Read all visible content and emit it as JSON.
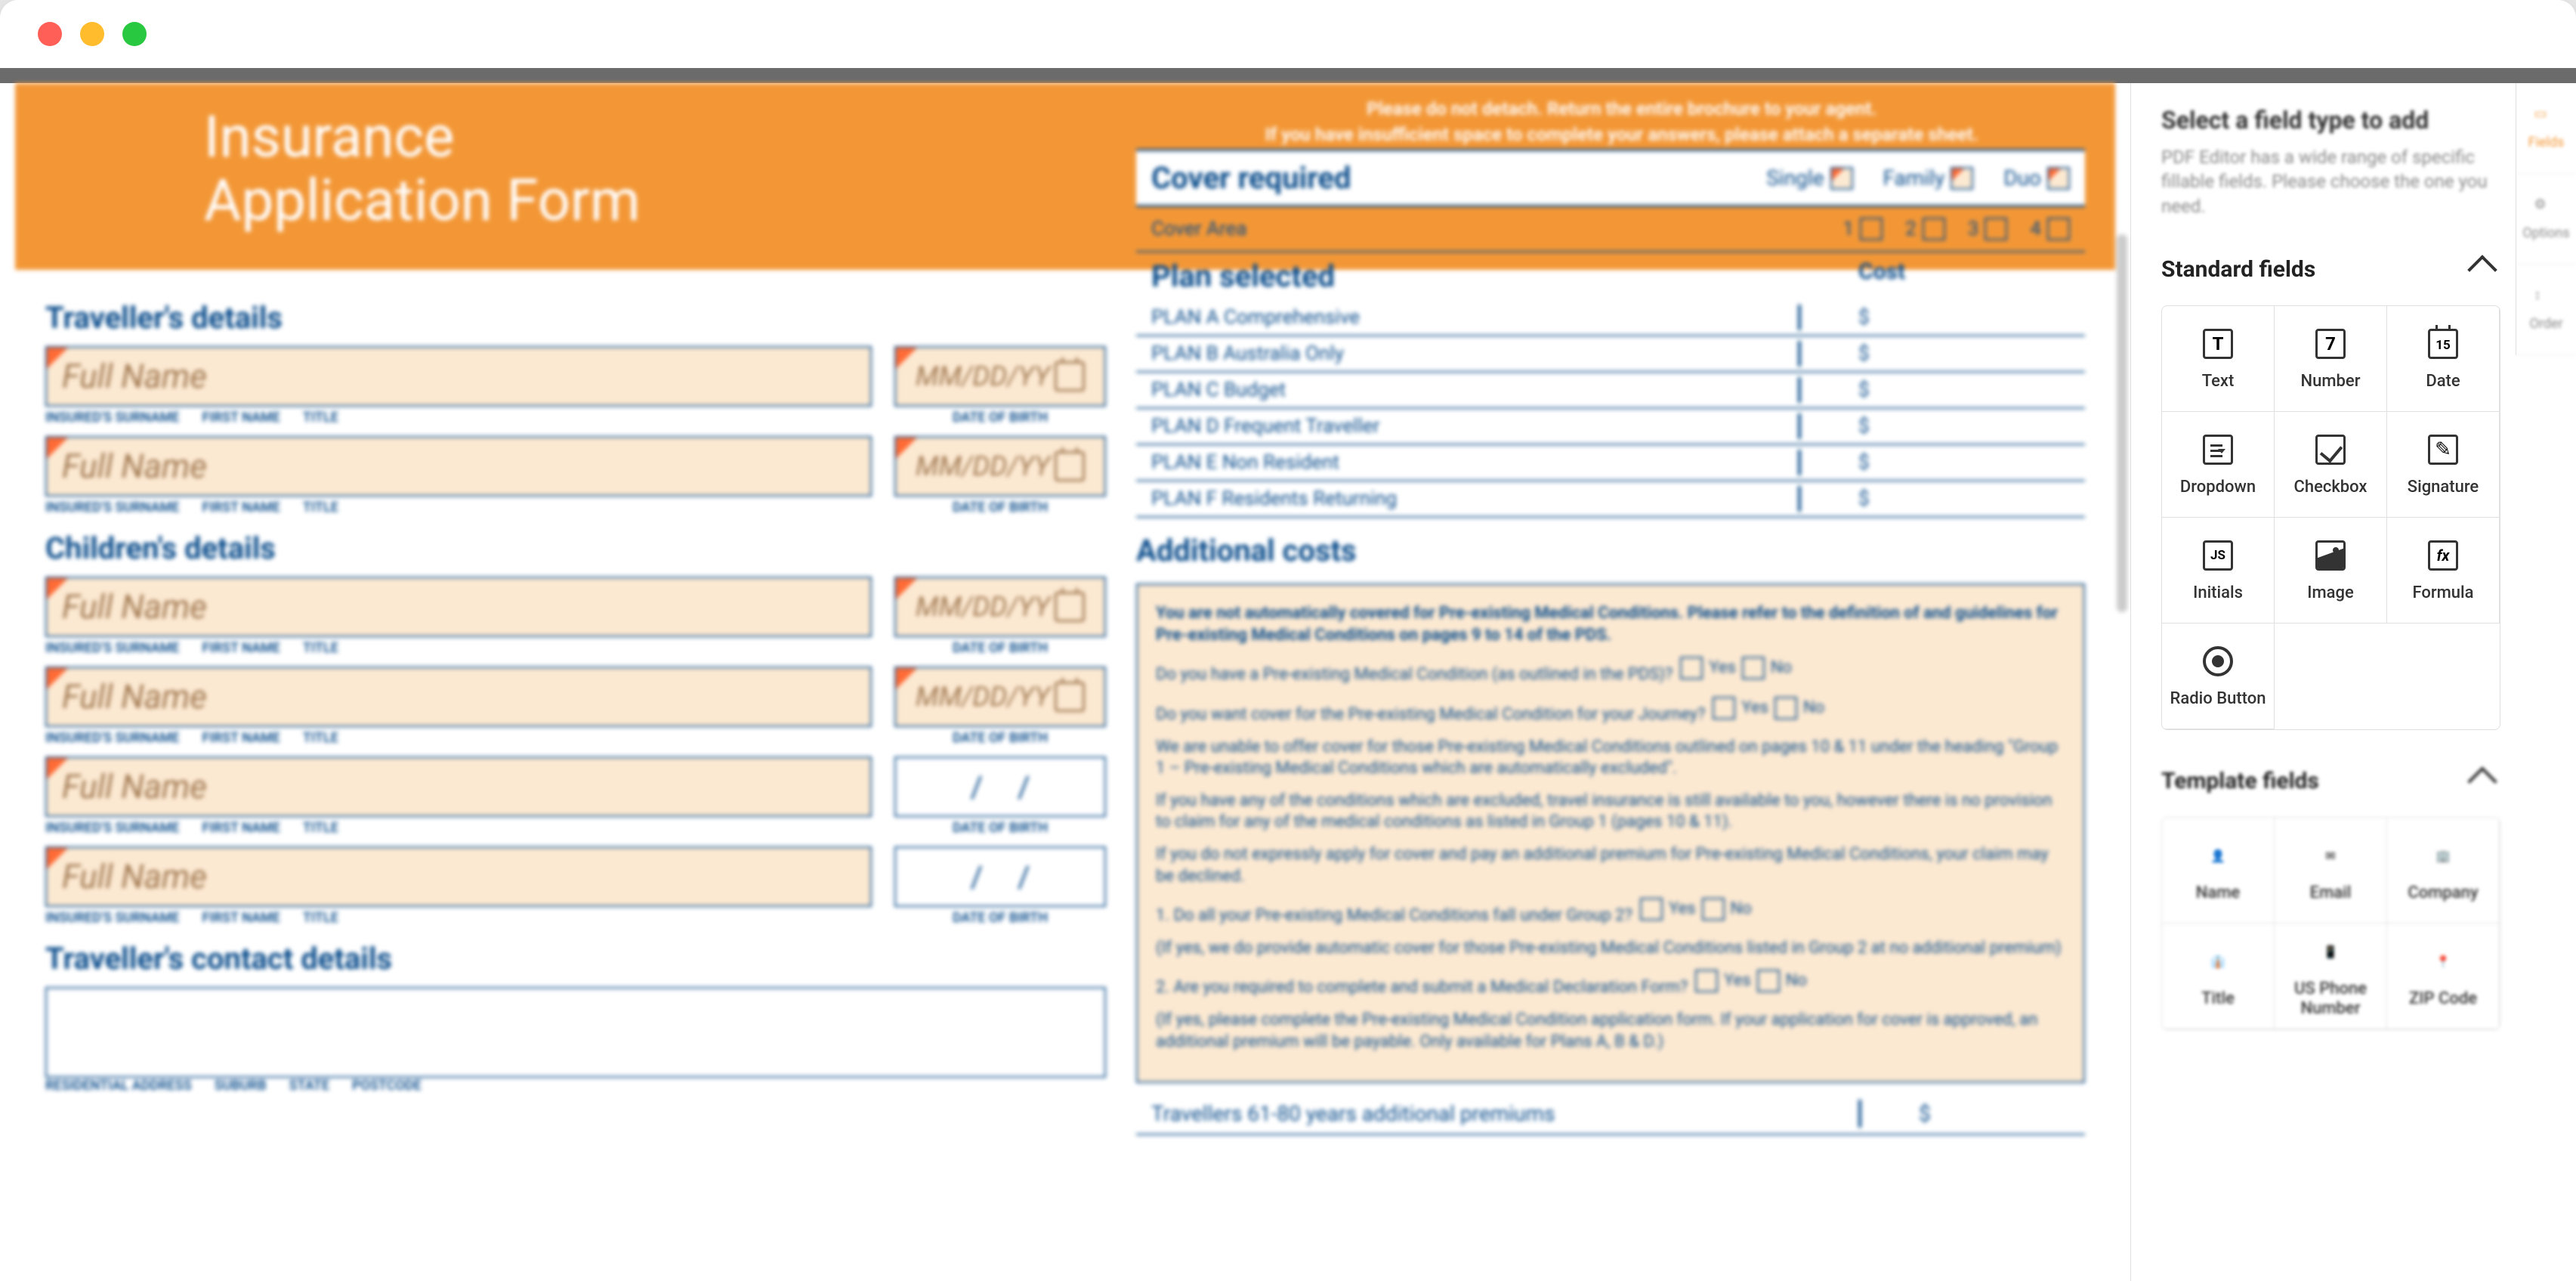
{
  "doc": {
    "header_title_l1": "Insurance",
    "header_title_l2": "Application Form",
    "header_notice_l1": "Please do not detach. Return the entire brochure to your agent.",
    "header_notice_l2": "If you have insufficient space to complete your answers, please attach a separate sheet.",
    "traveller_title": "Traveller's details",
    "children_title": "Children's details",
    "contact_title": "Traveller's contact details",
    "fullname_ph": "Full Name",
    "date_ph": "MM/DD/YY",
    "sublabels": {
      "surname": "INSURED'S SURNAME",
      "first": "FIRST NAME",
      "title": "TITLE",
      "dob": "DATE OF BIRTH"
    },
    "addr_labels": {
      "res": "RESIDENTIAL ADDRESS",
      "suburb": "SUBURB",
      "state": "STATE",
      "postcode": "POSTCODE"
    },
    "cover_required": "Cover required",
    "cover_opts": [
      "Single",
      "Family",
      "Duo"
    ],
    "cover_area": "Cover Area",
    "cover_area_nums": [
      "1",
      "2",
      "3",
      "4"
    ],
    "plan_selected": "Plan selected",
    "cost": "Cost",
    "plans": [
      "PLAN A Comprehensive",
      "PLAN B Australia Only",
      "PLAN C Budget",
      "PLAN D Frequent Traveller",
      "PLAN E Non Resident",
      "PLAN F Residents Returning"
    ],
    "dollar": "$",
    "additional_costs": "Additional costs",
    "addl_bold": "You are not automatically covered for Pre-existing Medical Conditions. Please refer to the definition of and guidelines for Pre-existing Medical Conditions on pages 9 to 14 of the PDS.",
    "addl_q1": "Do you have a Pre-existing Medical Condition (as outlined in the PDS)?",
    "addl_q2": "Do you want cover for the Pre-existing Medical Condition for your Journey?",
    "addl_p1": "We are unable to offer cover for those Pre-existing Medical Conditions outlined on pages 10 & 11 under the heading \"Group 1 – Pre-existing Medical Conditions which are automatically excluded\".",
    "addl_p2": "If you have any of the conditions which are excluded, travel insurance is still available to you, however there is no provision to claim for any of the medical conditions as listed in Group 1 (pages 10 & 11).",
    "addl_p3": "If you do not expressly apply for cover and pay an additional premium for Pre-existing Medical Conditions, your claim may be declined.",
    "addl_li1": "1. Do all your Pre-existing Medical Conditions fall under Group 2?",
    "addl_li1b": "(If yes, we do provide automatic cover for those Pre-existing Medical Conditions listed in Group 2 at no additional premium)",
    "addl_li2": "2. Are you required to complete and submit a Medical Declaration Form?",
    "addl_li2b": "(If yes, please complete the Pre-existing Medical Condition application form. If your application for cover is approved, an additional premium will be payable. Only available for Plans A, B & D.)",
    "yes": "Yes",
    "no": "No",
    "travellers_61": "Travellers 61-80 years additional premiums"
  },
  "sidebar": {
    "head_title": "Select a field type to add",
    "head_sub": "PDF Editor has a wide range of specific fillable fields. Please choose the one you need.",
    "tabs": {
      "fields": "Fields",
      "options": "Options",
      "order": "Order"
    },
    "standard_title": "Standard fields",
    "template_title": "Template fields",
    "standard": [
      "Text",
      "Number",
      "Date",
      "Dropdown",
      "Checkbox",
      "Signature",
      "Initials",
      "Image",
      "Formula",
      "Radio Button"
    ],
    "template": [
      "Name",
      "Email",
      "Company",
      "Title",
      "US Phone Number",
      "ZIP Code"
    ]
  }
}
